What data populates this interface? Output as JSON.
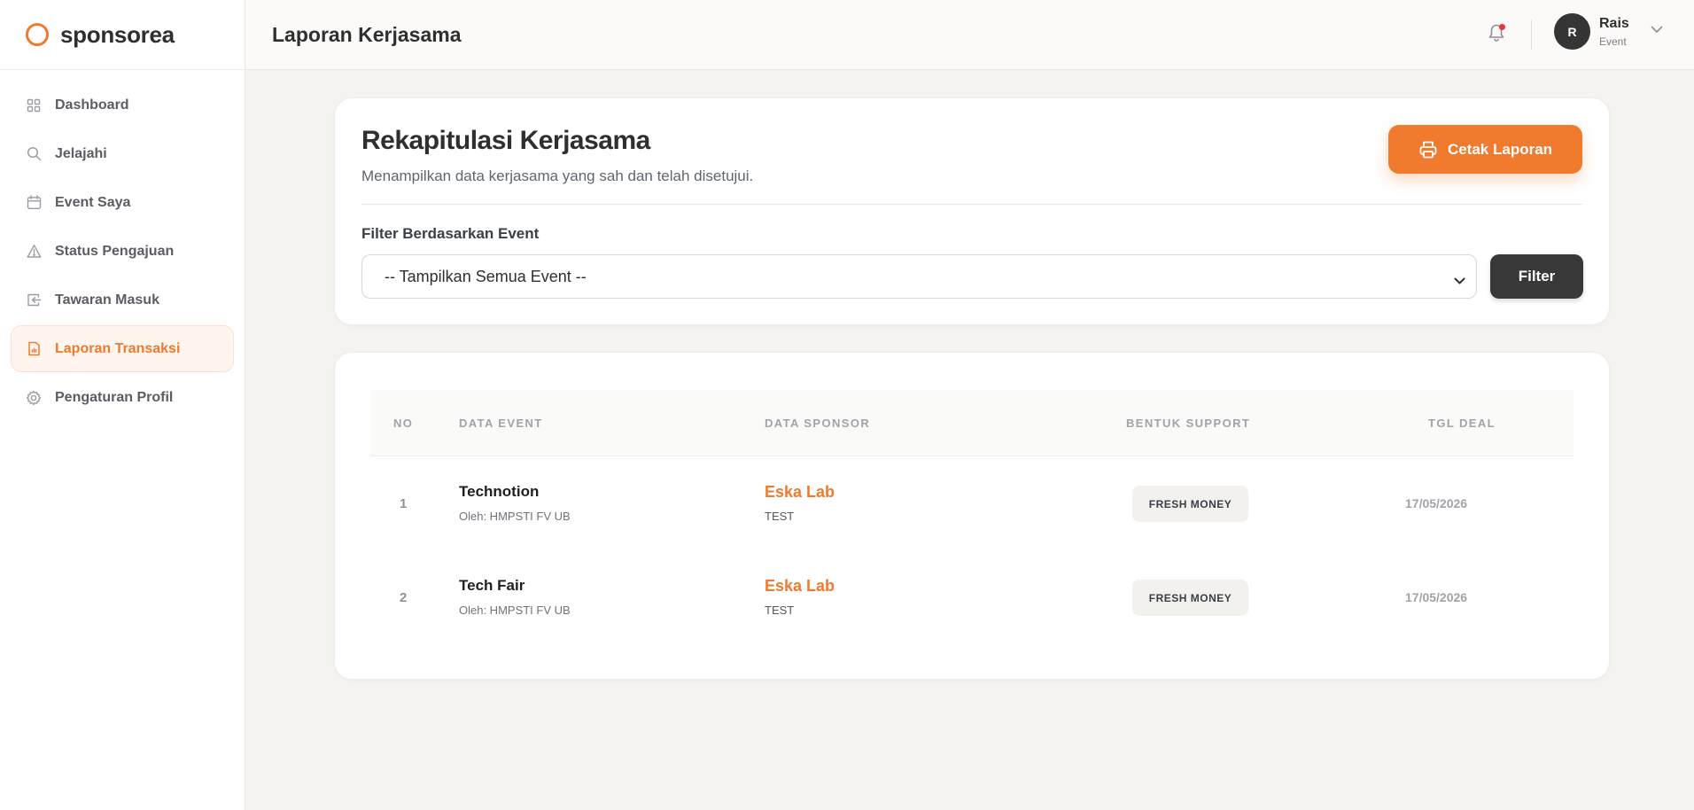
{
  "app": {
    "brand": "sponsorea",
    "accent": "#f07a2e"
  },
  "sidebar": {
    "items": [
      {
        "label": "Dashboard",
        "icon": "grid-icon",
        "active": false
      },
      {
        "label": "Jelajahi",
        "icon": "search-icon",
        "active": false
      },
      {
        "label": "Event Saya",
        "icon": "calendar-icon",
        "active": false
      },
      {
        "label": "Status Pengajuan",
        "icon": "warning-triangle-icon",
        "active": false
      },
      {
        "label": "Tawaran Masuk",
        "icon": "inbox-icon",
        "active": false
      },
      {
        "label": "Laporan Transaksi",
        "icon": "report-icon",
        "active": true
      },
      {
        "label": "Pengaturan Profil",
        "icon": "gear-icon",
        "active": false
      }
    ]
  },
  "header": {
    "title": "Laporan Kerjasama",
    "user": {
      "initial": "R",
      "name": "Rais",
      "role": "Event"
    }
  },
  "summary": {
    "title": "Rekapitulasi Kerjasama",
    "subtitle": "Menampilkan data kerjasama yang sah dan telah disetujui.",
    "print_label": "Cetak Laporan",
    "filter_label": "Filter Berdasarkan Event",
    "select_value": "-- Tampilkan Semua Event --",
    "filter_button": "Filter"
  },
  "table": {
    "headers": [
      "NO",
      "DATA EVENT",
      "DATA SPONSOR",
      "BENTUK SUPPORT",
      "TGL DEAL"
    ],
    "rows": [
      {
        "no": "1",
        "event": "Technotion",
        "organizer": "Oleh: HMPSTI FV UB",
        "sponsor": "Eska Lab",
        "sponsor_note": "TEST",
        "support": "FRESH MONEY",
        "date": "17/05/2026"
      },
      {
        "no": "2",
        "event": "Tech Fair",
        "organizer": "Oleh: HMPSTI FV UB",
        "sponsor": "Eska Lab",
        "sponsor_note": "TEST",
        "support": "FRESH MONEY",
        "date": "17/05/2026"
      }
    ]
  }
}
